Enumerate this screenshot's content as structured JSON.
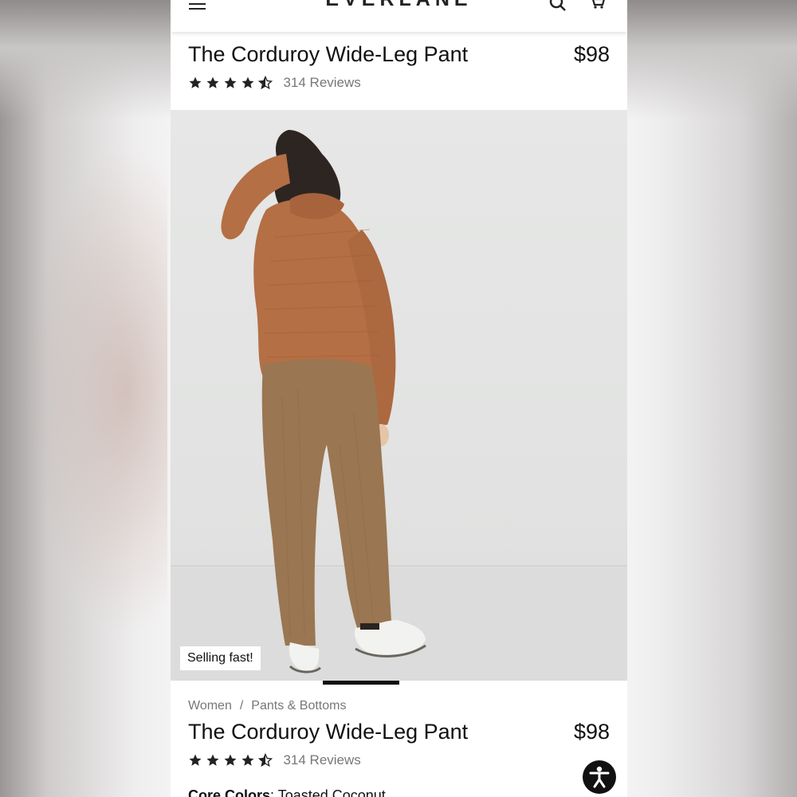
{
  "header": {
    "brand": "EVERLANE"
  },
  "product": {
    "title": "The Corduroy Wide-Leg Pant",
    "price": "$98",
    "rating_stars": 4.5,
    "reviews_label": "314 Reviews"
  },
  "gallery": {
    "badge": "Selling fast!",
    "sweater_color": "#b46f44",
    "pant_color": "#9a7652"
  },
  "breadcrumb": {
    "items": [
      "Women",
      "Pants & Bottoms"
    ],
    "separator": "/"
  },
  "details": {
    "colors_label": "Core Colors",
    "colors_value": "Toasted Coconut"
  },
  "icons": [
    "menu-icon",
    "search-icon",
    "cart-icon",
    "star-icon",
    "half-star-icon",
    "accessibility-icon"
  ]
}
